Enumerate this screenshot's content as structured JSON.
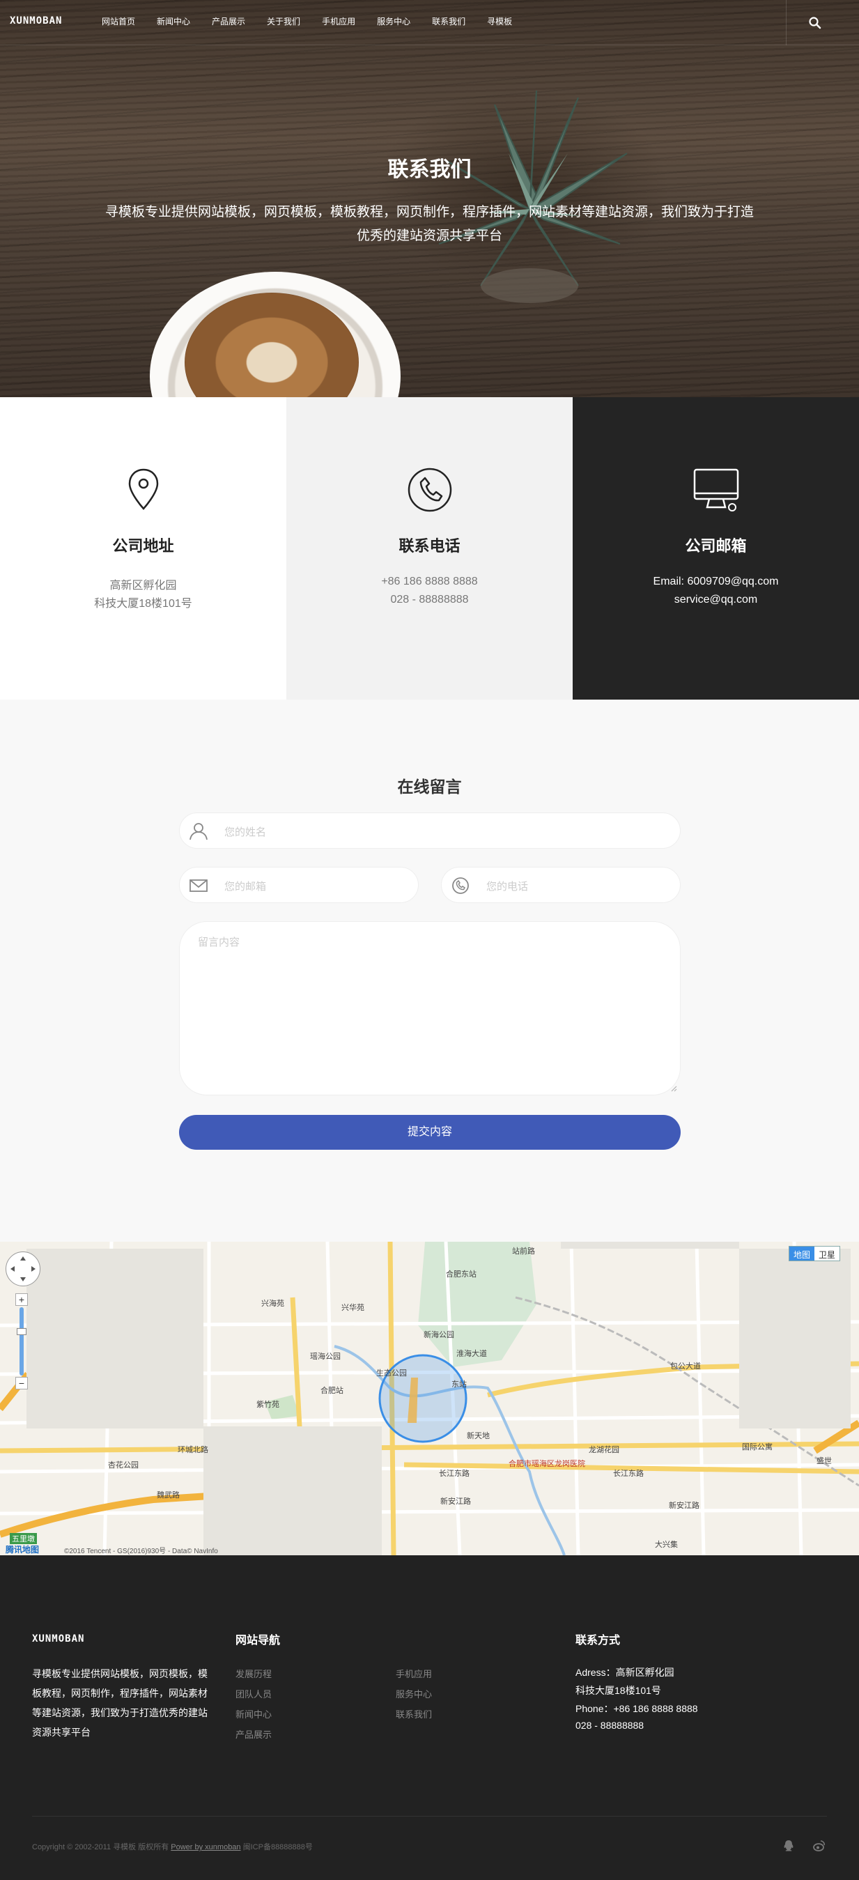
{
  "header": {
    "logo": "XUNMOBAN",
    "menu": [
      "网站首页",
      "新闻中心",
      "产品展示",
      "关于我们",
      "手机应用",
      "服务中心",
      "联系我们",
      "寻模板"
    ]
  },
  "hero": {
    "title": "联系我们",
    "desc_line1": "寻模板专业提供网站模板，网页模板，模板教程，网页制作，程序插件，网站素材等建站资源，我们致为于打造",
    "desc_line2": "优秀的建站资源共享平台"
  },
  "cards": [
    {
      "title": "公司地址",
      "line1": "高新区孵化园",
      "line2": "科技大厦18楼101号",
      "icon": "location-pin-icon"
    },
    {
      "title": "联系电话",
      "line1": "+86 186 8888 8888",
      "line2": "028 - 88888888",
      "icon": "phone-icon"
    },
    {
      "title": "公司邮箱",
      "line1": "Email: 6009709@qq.com",
      "line2": "service@qq.com",
      "icon": "monitor-icon"
    }
  ],
  "form": {
    "title": "在线留言",
    "name_placeholder": "您的姓名",
    "email_placeholder": "您的邮箱",
    "phone_placeholder": "您的电话",
    "message_placeholder": "留言内容",
    "submit_label": "提交内容"
  },
  "map": {
    "toggle": [
      "地图",
      "卫星"
    ],
    "brand": "腾讯地图",
    "credit": "©2016 Tencent - GS(2016)930号 - Data© NavInfo",
    "labels": {
      "l1": "合肥东站",
      "l2": "兴海苑",
      "l3": "兴华苑",
      "l4": "新海公园",
      "l5": "淮海大道",
      "l6": "瑶海公园",
      "l7": "生态公园",
      "l8": "合肥站",
      "l9": "紫竹苑",
      "l10": "东站",
      "l11": "新天地",
      "l12": "龙湖花园",
      "l13": "合肥市瑶海区龙岗医院",
      "l14": "长江东路",
      "l15": "新安江路",
      "l16": "杏花公园",
      "l17": "包公大道",
      "l18": "国际公寓",
      "l19": "长江东路",
      "l20": "新安江路",
      "l21": "大兴集",
      "l22": "环城北路",
      "l23": "五里墩",
      "l24": "魏武路",
      "l25": "站前路",
      "l26": "盛世"
    }
  },
  "footer": {
    "logo": "XUNMOBAN",
    "about": "寻模板专业提供网站模板，网页模板，模板教程，网页制作，程序插件，网站素材等建站资源，我们致为于打造优秀的建站资源共享平台",
    "nav_title": "网站导航",
    "nav_col1": [
      "发展历程",
      "团队人员",
      "新闻中心",
      "产品展示"
    ],
    "nav_col2": [
      "手机应用",
      "服务中心",
      "联系我们"
    ],
    "contact_title": "联系方式",
    "contact": [
      "Adress：高新区孵化园",
      "科技大厦18楼101号",
      "Phone：+86 186 8888 8888",
      "028 - 88888888"
    ],
    "copyright_pre": "Copyright © 2002-2011 寻模板 版权所有",
    "copyright_link": "Power by xunmoban",
    "copyright_post": "闽ICP备88888888号"
  }
}
